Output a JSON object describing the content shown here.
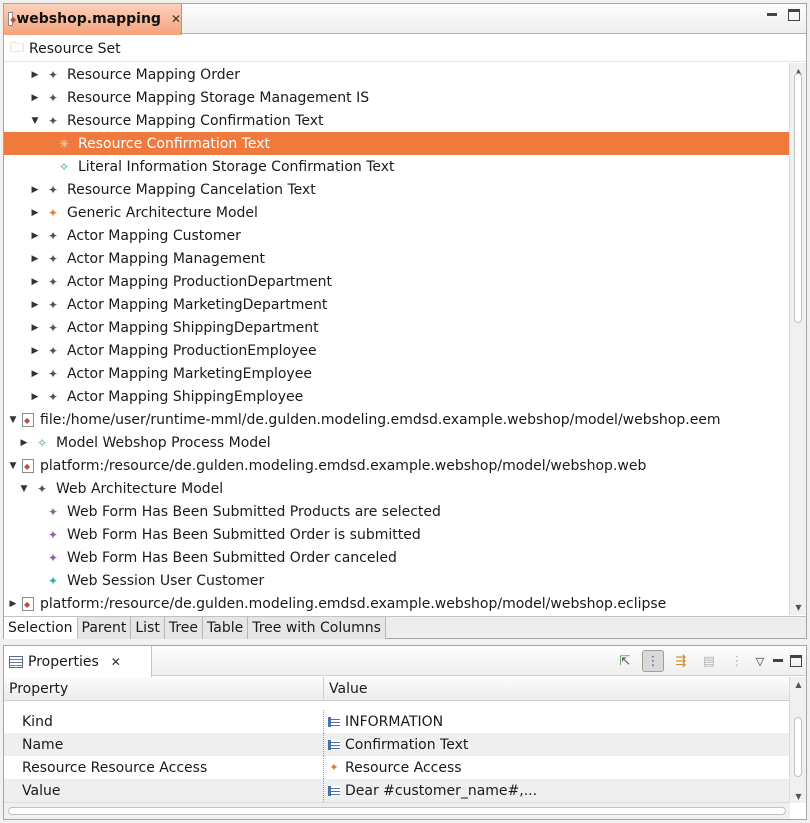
{
  "editor": {
    "tab_title": "webshop.mapping",
    "breadcrumb": "Resource Set",
    "rows": [
      {
        "indent": 2,
        "twisty": "▶",
        "icon": "star-gray",
        "label": "Resource Mapping Order"
      },
      {
        "indent": 2,
        "twisty": "▶",
        "icon": "star-gray",
        "label": "Resource Mapping Storage Management IS"
      },
      {
        "indent": 2,
        "twisty": "▼",
        "icon": "star-gray",
        "label": "Resource Mapping Confirmation Text"
      },
      {
        "indent": 3,
        "twisty": "",
        "icon": "star-white",
        "label": "Resource Confirmation Text",
        "selected": true
      },
      {
        "indent": 3,
        "twisty": "",
        "icon": "star-green",
        "label": "Literal Information Storage Confirmation Text"
      },
      {
        "indent": 2,
        "twisty": "▶",
        "icon": "star-gray",
        "label": "Resource Mapping Cancelation Text"
      },
      {
        "indent": 2,
        "twisty": "▶",
        "icon": "star-orange",
        "label": "Generic Architecture Model"
      },
      {
        "indent": 2,
        "twisty": "▶",
        "icon": "star-gray",
        "label": "Actor Mapping Customer"
      },
      {
        "indent": 2,
        "twisty": "▶",
        "icon": "star-gray",
        "label": "Actor Mapping Management"
      },
      {
        "indent": 2,
        "twisty": "▶",
        "icon": "star-gray",
        "label": "Actor Mapping ProductionDepartment"
      },
      {
        "indent": 2,
        "twisty": "▶",
        "icon": "star-gray",
        "label": "Actor Mapping MarketingDepartment"
      },
      {
        "indent": 2,
        "twisty": "▶",
        "icon": "star-gray",
        "label": "Actor Mapping ShippingDepartment"
      },
      {
        "indent": 2,
        "twisty": "▶",
        "icon": "star-gray",
        "label": "Actor Mapping ProductionEmployee"
      },
      {
        "indent": 2,
        "twisty": "▶",
        "icon": "star-gray",
        "label": "Actor Mapping MarketingEmployee"
      },
      {
        "indent": 2,
        "twisty": "▶",
        "icon": "star-gray",
        "label": "Actor Mapping ShippingEmployee"
      },
      {
        "indent": 0,
        "twisty": "▼",
        "icon": "file",
        "label": "file:/home/user/runtime-mml/de.gulden.modeling.emdsd.example.webshop/model/webshop.eem"
      },
      {
        "indent": 1,
        "twisty": "▶",
        "icon": "star-green",
        "label": "Model Webshop Process Model"
      },
      {
        "indent": 0,
        "twisty": "▼",
        "icon": "file",
        "label": "platform:/resource/de.gulden.modeling.emdsd.example.webshop/model/webshop.web"
      },
      {
        "indent": 1,
        "twisty": "▼",
        "icon": "star-gray",
        "label": "Web Architecture Model"
      },
      {
        "indent": 2,
        "twisty": "",
        "icon": "star-purple",
        "label": "Web Form Has Been Submitted Products  are selected"
      },
      {
        "indent": 2,
        "twisty": "",
        "icon": "star-purple",
        "label": "Web Form Has Been Submitted Order is submitted"
      },
      {
        "indent": 2,
        "twisty": "",
        "icon": "star-purple",
        "label": "Web Form Has Been Submitted Order canceled"
      },
      {
        "indent": 2,
        "twisty": "",
        "icon": "star-teal",
        "label": "Web Session User Customer"
      },
      {
        "indent": 0,
        "twisty": "▶",
        "icon": "file",
        "label": "platform:/resource/de.gulden.modeling.emdsd.example.webshop/model/webshop.eclipse"
      }
    ],
    "bottom_tabs": [
      "Selection",
      "Parent",
      "List",
      "Tree",
      "Table",
      "Tree with Columns"
    ],
    "active_bottom_tab": 0
  },
  "properties": {
    "tab_title": "Properties",
    "headers": {
      "property": "Property",
      "value": "Value"
    },
    "rows": [
      {
        "property": "Kind",
        "value": "INFORMATION",
        "icon": "list"
      },
      {
        "property": "Name",
        "value": "Confirmation Text",
        "icon": "list"
      },
      {
        "property": "Resource Resource Access",
        "value": "Resource Access",
        "icon": "star-orange"
      },
      {
        "property": "Value",
        "value": "Dear #customer_name#,...",
        "icon": "list"
      }
    ]
  },
  "colors": {
    "selection": "#f07a3e",
    "active_tab": "#f5a37c"
  }
}
